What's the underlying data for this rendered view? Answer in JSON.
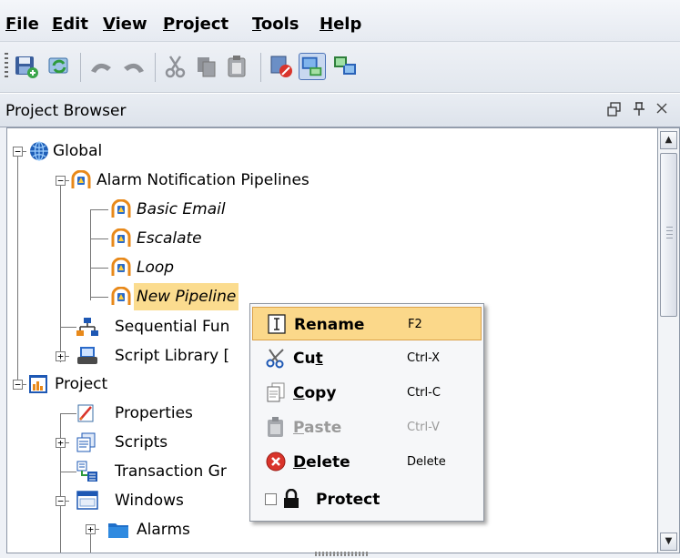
{
  "menu": [
    {
      "label": "File",
      "mnemonic": "F",
      "rest": "ile"
    },
    {
      "label": "Edit",
      "mnemonic": "E",
      "rest": "dit"
    },
    {
      "label": "View",
      "mnemonic": "V",
      "rest": "iew"
    },
    {
      "label": "Project",
      "mnemonic": "P",
      "rest": "roject"
    },
    {
      "label": "Tools",
      "mnemonic": "T",
      "rest": "ools"
    },
    {
      "label": "Help",
      "mnemonic": "H",
      "rest": "elp"
    }
  ],
  "toolbar": {
    "icons": [
      "save-icon",
      "refresh-icon",
      "undo-icon",
      "redo-icon",
      "cut-icon",
      "copy-icon",
      "paste-icon",
      "disconnect-icon",
      "computer-icon",
      "network-icon"
    ]
  },
  "panel": {
    "title": "Project Browser",
    "controls": [
      "ㅁ",
      "ㅍ",
      "×"
    ]
  },
  "tree": {
    "global": "Global",
    "alarm_pipelines": "Alarm Notification Pipelines",
    "pipelines": [
      "Basic Email",
      "Escalate",
      "Loop",
      "New Pipeline"
    ],
    "sequential": "Sequential Fun",
    "script_library": "Script Library [",
    "project": "Project",
    "properties": "Properties",
    "scripts": "Scripts",
    "transaction": "Transaction Gr",
    "windows": "Windows",
    "alarms": "Alarms"
  },
  "context_menu": {
    "items": [
      {
        "pre": "",
        "mn": "",
        "post": "Rename",
        "accel": "F2"
      },
      {
        "pre": "Cu",
        "mn": "t",
        "post": "",
        "accel": "Ctrl-X"
      },
      {
        "pre": "",
        "mn": "C",
        "post": "opy",
        "accel": "Ctrl-C"
      },
      {
        "pre": "",
        "mn": "P",
        "post": "aste",
        "accel": "Ctrl-V"
      },
      {
        "pre": "",
        "mn": "D",
        "post": "elete",
        "accel": "Delete"
      },
      {
        "pre": "",
        "mn": "",
        "post": "Protect",
        "accel": ""
      }
    ]
  },
  "colors": {
    "selection": "#fbdc8f",
    "menu_highlight": "#fbd88a",
    "delete_red": "#d9342b"
  }
}
